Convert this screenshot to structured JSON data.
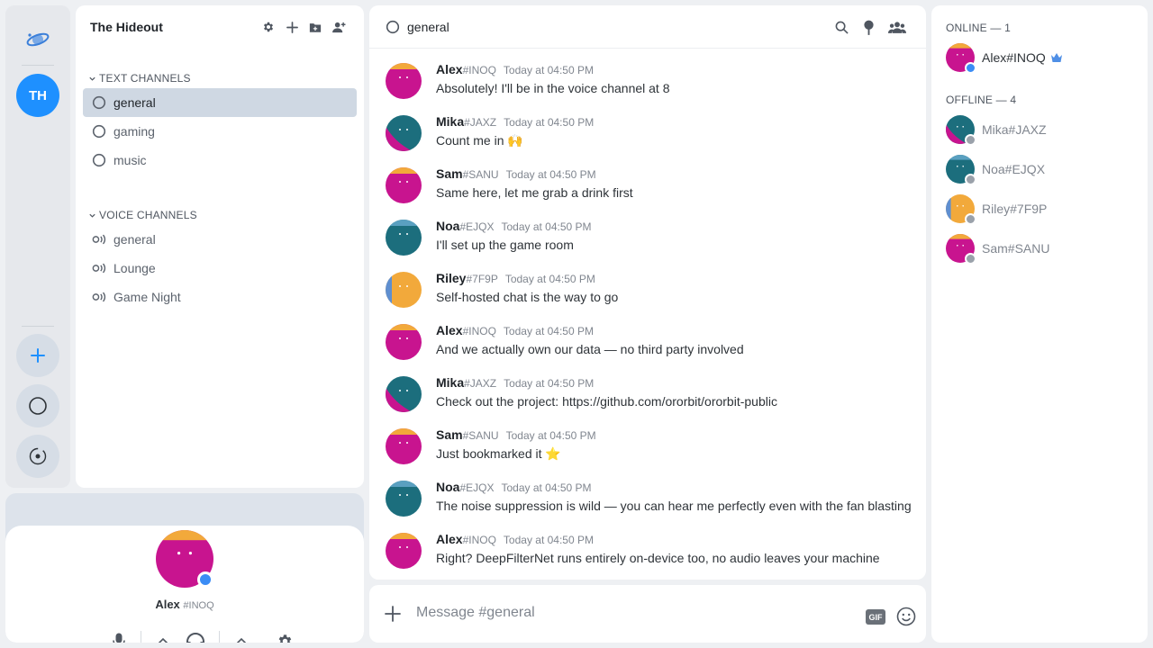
{
  "server": {
    "initials": "TH",
    "name": "The Hideout"
  },
  "categories": {
    "text": "TEXT CHANNELS",
    "voice": "VOICE CHANNELS"
  },
  "text_channels": [
    {
      "label": "general",
      "active": true
    },
    {
      "label": "gaming",
      "active": false
    },
    {
      "label": "music",
      "active": false
    }
  ],
  "voice_channels": [
    {
      "label": "general"
    },
    {
      "label": "Lounge"
    },
    {
      "label": "Game Night"
    }
  ],
  "current_user": {
    "name": "Alex",
    "tag": "#INOQ"
  },
  "chat": {
    "channel_name": "general",
    "composer_placeholder": "Message #general",
    "gif_label": "GIF"
  },
  "messages": [
    {
      "author": "Alex",
      "tag": "#INOQ",
      "time": "Today at 04:50 PM",
      "text": "Absolutely! I'll be in the voice channel at 8",
      "avatar": "alex"
    },
    {
      "author": "Mika",
      "tag": "#JAXZ",
      "time": "Today at 04:50 PM",
      "text": "Count me in 🙌",
      "avatar": "mika"
    },
    {
      "author": "Sam",
      "tag": "#SANU",
      "time": "Today at 04:50 PM",
      "text": "Same here, let me grab a drink first",
      "avatar": "sam"
    },
    {
      "author": "Noa",
      "tag": "#EJQX",
      "time": "Today at 04:50 PM",
      "text": "I'll set up the game room",
      "avatar": "noa"
    },
    {
      "author": "Riley",
      "tag": "#7F9P",
      "time": "Today at 04:50 PM",
      "text": "Self-hosted chat is the way to go",
      "avatar": "riley"
    },
    {
      "author": "Alex",
      "tag": "#INOQ",
      "time": "Today at 04:50 PM",
      "text": "And we actually own our data — no third party involved",
      "avatar": "alex"
    },
    {
      "author": "Mika",
      "tag": "#JAXZ",
      "time": "Today at 04:50 PM",
      "text": "Check out the project: https://github.com/ororbit/ororbit-public",
      "avatar": "mika"
    },
    {
      "author": "Sam",
      "tag": "#SANU",
      "time": "Today at 04:50 PM",
      "text": "Just bookmarked it ⭐",
      "avatar": "sam"
    },
    {
      "author": "Noa",
      "tag": "#EJQX",
      "time": "Today at 04:50 PM",
      "text": "The noise suppression is wild — you can hear me perfectly even with the fan blasting",
      "avatar": "noa"
    },
    {
      "author": "Alex",
      "tag": "#INOQ",
      "time": "Today at 04:50 PM",
      "text": "Right? DeepFilterNet runs entirely on-device too, no audio leaves your machine",
      "avatar": "alex"
    }
  ],
  "members": {
    "online_header": "ONLINE — 1",
    "offline_header": "OFFLINE — 4",
    "online": [
      {
        "name": "Alex#INOQ",
        "avatar": "alex",
        "owner": true
      }
    ],
    "offline": [
      {
        "name": "Mika#JAXZ",
        "avatar": "mika"
      },
      {
        "name": "Noa#EJQX",
        "avatar": "noa"
      },
      {
        "name": "Riley#7F9P",
        "avatar": "riley"
      },
      {
        "name": "Sam#SANU",
        "avatar": "sam"
      }
    ]
  },
  "colors": {
    "accent": "#1e90ff",
    "online_status": "#3b8cf5",
    "offline_status": "#9aa1aa",
    "crown": "#4f8fe6"
  },
  "avatar_styles": {
    "alex": {
      "main": "#c8148f",
      "accent": "#f2a93b",
      "split": "top"
    },
    "sam": {
      "main": "#c8148f",
      "accent": "#f2a93b",
      "split": "top"
    },
    "mika": {
      "main": "#1c6e7d",
      "accent": "#c8148f",
      "split": "diag"
    },
    "noa": {
      "main": "#1c6e7d",
      "accent": "#5aa0c0",
      "split": "top"
    },
    "riley": {
      "main": "#f2a93b",
      "accent": "#5f8fd0",
      "split": "left"
    }
  }
}
